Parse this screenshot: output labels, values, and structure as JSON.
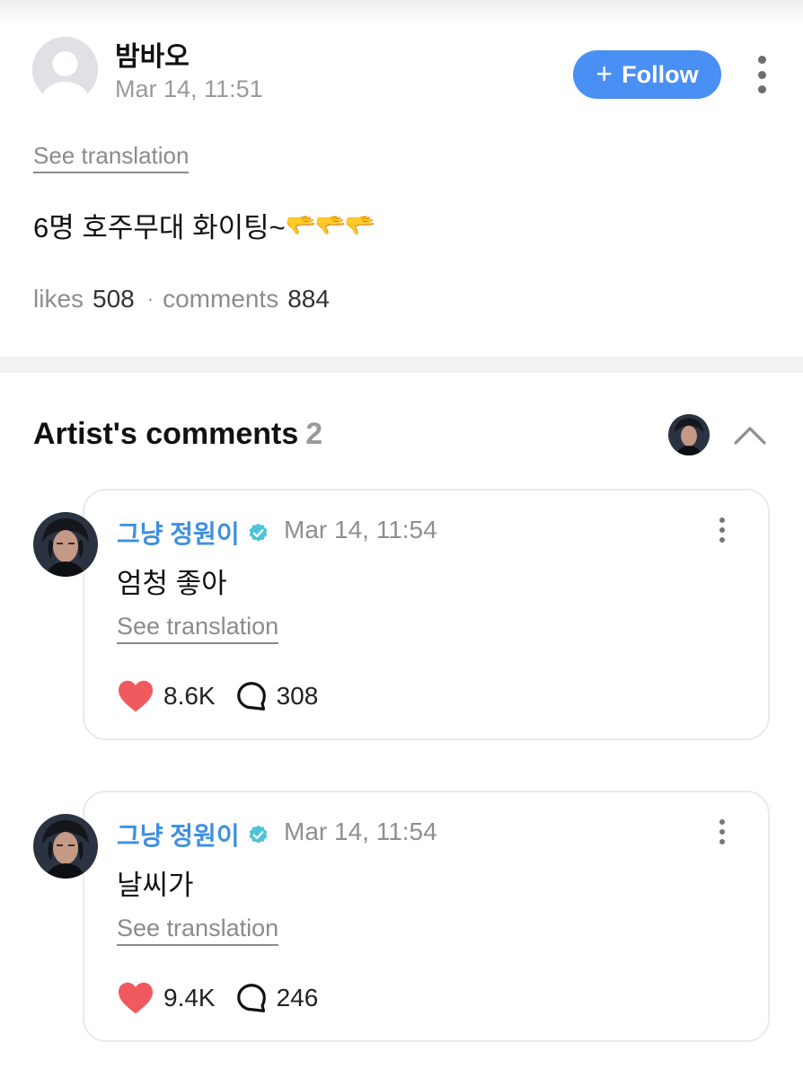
{
  "post": {
    "author": "밤바오",
    "time": "Mar 14, 11:51",
    "follow_label": "Follow",
    "see_translation": "See translation",
    "body": "6명 호주무대 화이팅~",
    "body_emoji": [
      "🫳",
      "🫳",
      "🫳"
    ],
    "likes_label": "likes",
    "likes": "508",
    "comments_label": "comments",
    "comments": "884"
  },
  "artist_comments": {
    "title": "Artist's comments",
    "count": "2",
    "items": [
      {
        "name": "그냥 정원이",
        "time": "Mar 14, 11:54",
        "text": "엄청 좋아",
        "see_translation": "See translation",
        "likes": "8.6K",
        "replies": "308"
      },
      {
        "name": "그냥 정원이",
        "time": "Mar 14, 11:54",
        "text": "날씨가",
        "see_translation": "See translation",
        "likes": "9.4K",
        "replies": "246"
      }
    ]
  },
  "colors": {
    "accent": "#4a8ff3",
    "artist_name": "#3f8fe0",
    "verified": "#4cc3d9",
    "heart": "#f05a5f"
  }
}
